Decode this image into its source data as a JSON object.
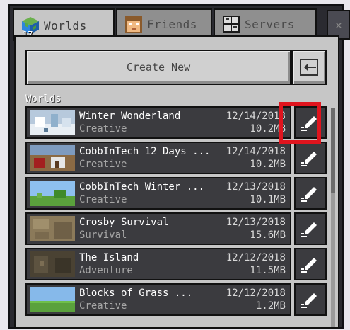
{
  "tabs": [
    {
      "label": "Worlds",
      "icon": "globe-icon",
      "count": "17",
      "active": true
    },
    {
      "label": "Friends",
      "icon": "friend-face-icon",
      "active": false
    },
    {
      "label": "Servers",
      "icon": "server-icon",
      "active": false
    }
  ],
  "close_label": "×",
  "create_new_label": "Create New",
  "import_icon": "import-arrow-icon",
  "section_label": "Worlds",
  "worlds": [
    {
      "title": "Winter Wonderland",
      "mode": "Creative",
      "date": "12/14/2018",
      "size": "10.2MB",
      "thumb_icon": "snow-thumbnail"
    },
    {
      "title": "CobbInTech 12 Days ...",
      "mode": "Creative",
      "date": "12/14/2018",
      "size": "10.2MB",
      "thumb_icon": "house-thumbnail"
    },
    {
      "title": "CobbInTech Winter ...",
      "mode": "Creative",
      "date": "12/13/2018",
      "size": "10.1MB",
      "thumb_icon": "sky-grass-thumbnail"
    },
    {
      "title": "Crosby Survival",
      "mode": "Survival",
      "date": "12/13/2018",
      "size": "15.6MB",
      "thumb_icon": "wood-thumbnail"
    },
    {
      "title": "The Island",
      "mode": "Adventure",
      "date": "12/12/2018",
      "size": "11.5MB",
      "thumb_icon": "cave-thumbnail"
    },
    {
      "title": "Blocks of Grass ...",
      "mode": "Creative",
      "date": "12/12/2018",
      "size": "1.2MB",
      "thumb_icon": "grass-thumbnail"
    }
  ],
  "colors": {
    "highlight": "#e0141e",
    "panel": "#c6c6c6",
    "row": "#3b3b3f"
  }
}
